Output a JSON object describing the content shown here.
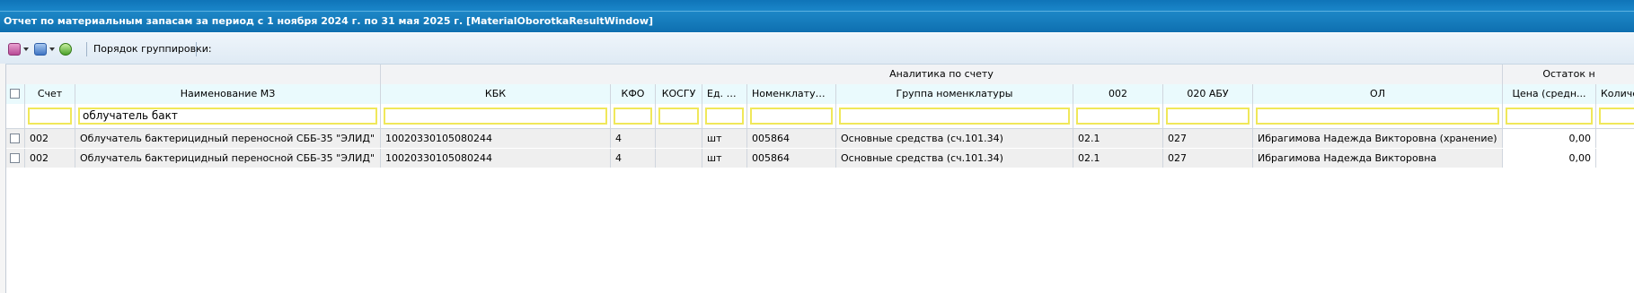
{
  "window": {
    "title": "Отчет по материальным запасам за период с 1 ноября 2024 г. по 31 мая 2025 г. [MaterialOborotkaResultWindow]"
  },
  "toolbar": {
    "add_icon": "add-icon",
    "export_icon": "export-icon",
    "refresh_icon": "refresh-icon",
    "grouping_label": "Порядок группировки:"
  },
  "grid": {
    "group_headers": {
      "analytics": "Аналитика по счету",
      "balance": "Остаток н"
    },
    "columns": {
      "schet": "Счет",
      "name": "Наименование МЗ",
      "kbk": "КБК",
      "kfo": "КФО",
      "kosgu": "КОСГУ",
      "unit": "Ед. из...",
      "nomnum": "Номенклатурны...",
      "nomgroup": "Группа номенклатуры",
      "c002": "002",
      "c020": "020 АБУ",
      "ol": "ОЛ",
      "price": "Цена (средн...",
      "qty": "Количе"
    },
    "filter": {
      "name_value": "облучатель бакт"
    },
    "rows": [
      {
        "schet": "002",
        "name": "Облучатель бактерицидный переносной СББ-35 \"ЭЛИД\"",
        "kbk": "10020330105080244",
        "kfo": "4",
        "kosgu": "",
        "unit": "шт",
        "nomnum": "005864",
        "nomgroup": "Основные средства (сч.101.34)",
        "c002": "02.1",
        "c020": "027",
        "ol": "Ибрагимова Надежда Викторовна (хранение)",
        "price": "0,00",
        "qty": ""
      },
      {
        "schet": "002",
        "name": "Облучатель бактерицидный переносной СББ-35 \"ЭЛИД\"",
        "kbk": "10020330105080244",
        "kfo": "4",
        "kosgu": "",
        "unit": "шт",
        "nomnum": "005864",
        "nomgroup": "Основные средства (сч.101.34)",
        "c002": "02.1",
        "c020": "027",
        "ol": "Ибрагимова Надежда Викторовна",
        "price": "0,00",
        "qty": ""
      }
    ]
  }
}
